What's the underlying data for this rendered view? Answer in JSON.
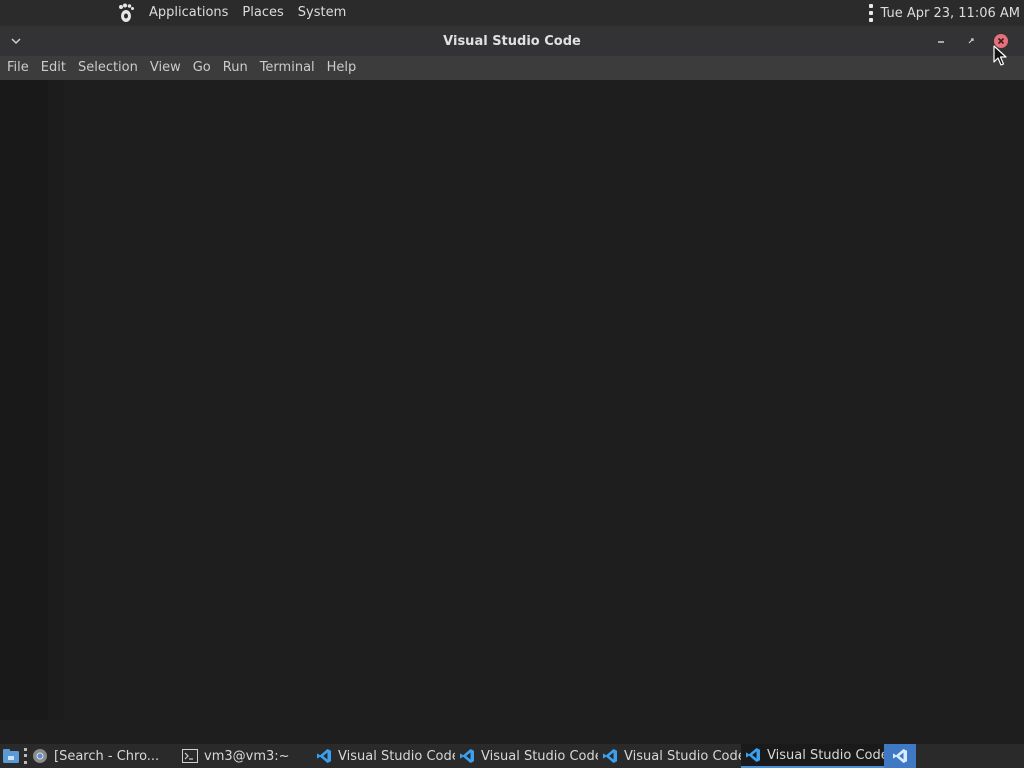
{
  "top_panel": {
    "menus": [
      "Applications",
      "Places",
      "System"
    ],
    "clock": "Tue Apr 23, 11:06 AM"
  },
  "window": {
    "title": "Visual Studio Code"
  },
  "menubar": {
    "items": [
      "File",
      "Edit",
      "Selection",
      "View",
      "Go",
      "Run",
      "Terminal",
      "Help"
    ]
  },
  "taskbar": {
    "tasks": [
      {
        "label": "[Search - Chro...",
        "icon": "terminal-window-icon"
      },
      {
        "label": "vm3@vm3:~",
        "icon": "terminal-icon"
      },
      {
        "label": "Visual Studio Code",
        "icon": "vscode-icon"
      },
      {
        "label": "Visual Studio Code",
        "icon": "vscode-icon"
      },
      {
        "label": "Visual Studio Code",
        "icon": "vscode-icon"
      },
      {
        "label": "Visual Studio Code",
        "icon": "vscode-icon",
        "active": true
      }
    ]
  },
  "colors": {
    "panel": "#2b2b2b",
    "titlebar": "#333335",
    "menubar": "#3c3c3c",
    "editor": "#1e1e1e",
    "close_button": "#e8707a",
    "vscode_blue": "#3aa0f0",
    "tray_blue": "#3f79c3"
  }
}
